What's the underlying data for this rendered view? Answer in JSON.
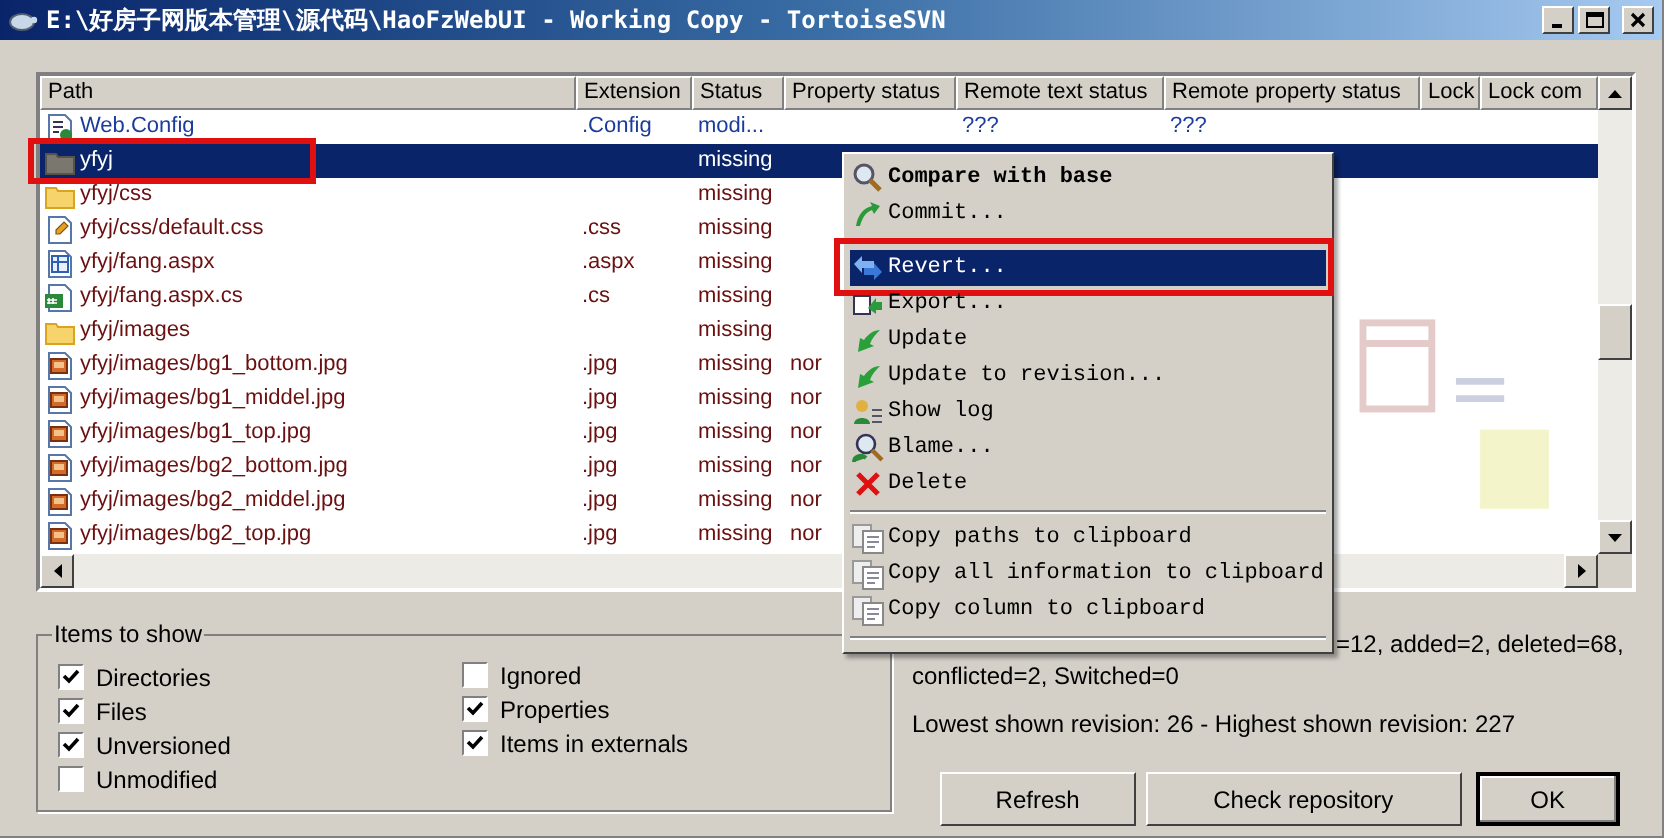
{
  "window": {
    "title": "E:\\好房子网版本管理\\源代码\\HaoFzWebUI - Working Copy - TortoiseSVN"
  },
  "list": {
    "columns": [
      {
        "label": "Path"
      },
      {
        "label": "Extension"
      },
      {
        "label": "Status"
      },
      {
        "label": "Property status"
      },
      {
        "label": "Remote text status"
      },
      {
        "label": "Remote property status"
      },
      {
        "label": "Lock"
      },
      {
        "label": "Lock com"
      }
    ],
    "rows": [
      {
        "kind": "config",
        "path": "Web.Config",
        "extension": ".Config",
        "status": "modi...",
        "remote_text_status": "???",
        "remote_property_status": "???",
        "color": "#1c3c9c",
        "selected": false,
        "highlighted": false
      },
      {
        "kind": "folder-gray",
        "path": "yfyj",
        "status": "missing",
        "selected": true,
        "highlighted": true
      },
      {
        "kind": "folder",
        "path": "yfyj/css",
        "status": "missing",
        "color": "#6b1010",
        "selected": false,
        "highlighted": false
      },
      {
        "kind": "css",
        "path": "yfyj/css/default.css",
        "extension": ".css",
        "status": "missing",
        "color": "#6b1010",
        "selected": false,
        "highlighted": false
      },
      {
        "kind": "aspx",
        "path": "yfyj/fang.aspx",
        "extension": ".aspx",
        "status": "missing",
        "color": "#6b1010",
        "selected": false,
        "highlighted": false
      },
      {
        "kind": "cs",
        "path": "yfyj/fang.aspx.cs",
        "extension": ".cs",
        "status": "missing",
        "color": "#6b1010",
        "selected": false,
        "highlighted": false
      },
      {
        "kind": "folder",
        "path": "yfyj/images",
        "status": "missing",
        "color": "#6b1010",
        "selected": false,
        "highlighted": false
      },
      {
        "kind": "image",
        "path": "yfyj/images/bg1_bottom.jpg",
        "extension": ".jpg",
        "status": "missing",
        "property_status": "nor",
        "color": "#6b1010",
        "selected": false,
        "highlighted": false
      },
      {
        "kind": "image",
        "path": "yfyj/images/bg1_middel.jpg",
        "extension": ".jpg",
        "status": "missing",
        "property_status": "nor",
        "color": "#6b1010",
        "selected": false,
        "highlighted": false
      },
      {
        "kind": "image",
        "path": "yfyj/images/bg1_top.jpg",
        "extension": ".jpg",
        "status": "missing",
        "property_status": "nor",
        "color": "#6b1010",
        "selected": false,
        "highlighted": false
      },
      {
        "kind": "image",
        "path": "yfyj/images/bg2_bottom.jpg",
        "extension": ".jpg",
        "status": "missing",
        "property_status": "nor",
        "color": "#6b1010",
        "selected": false,
        "highlighted": false
      },
      {
        "kind": "image",
        "path": "yfyj/images/bg2_middel.jpg",
        "extension": ".jpg",
        "status": "missing",
        "property_status": "nor",
        "color": "#6b1010",
        "selected": false,
        "highlighted": false
      },
      {
        "kind": "image",
        "path": "yfyj/images/bg2_top.jpg",
        "extension": ".jpg",
        "status": "missing",
        "property_status": "nor",
        "color": "#6b1010",
        "selected": false,
        "highlighted": false
      }
    ]
  },
  "context_menu": {
    "items": [
      {
        "kind": "compare",
        "label": "Compare with base",
        "default": true,
        "selected": false,
        "highlighted": false
      },
      {
        "kind": "commit",
        "label": "Commit...",
        "default": false,
        "selected": false,
        "highlighted": false
      },
      {
        "kind": "gap"
      },
      {
        "kind": "revert",
        "label": "Revert...",
        "default": false,
        "selected": true,
        "highlighted": true
      },
      {
        "kind": "export",
        "label": "Export...",
        "default": false,
        "selected": false,
        "highlighted": false
      },
      {
        "kind": "update",
        "label": "Update",
        "default": false,
        "selected": false,
        "highlighted": false
      },
      {
        "kind": "update",
        "label": "Update to revision...",
        "default": false,
        "selected": false,
        "highlighted": false
      },
      {
        "kind": "log",
        "label": "Show log",
        "default": false,
        "selected": false,
        "highlighted": false
      },
      {
        "kind": "blame",
        "label": "Blame...",
        "default": false,
        "selected": false,
        "highlighted": false
      },
      {
        "kind": "delete",
        "label": "Delete",
        "default": false,
        "selected": false,
        "highlighted": false
      },
      {
        "kind": "separator"
      },
      {
        "kind": "copy",
        "label": "Copy paths to clipboard",
        "default": false,
        "selected": false,
        "highlighted": false
      },
      {
        "kind": "copy",
        "label": "Copy all information to clipboard",
        "default": false,
        "selected": false,
        "highlighted": false
      },
      {
        "kind": "copy",
        "label": "Copy column to clipboard",
        "default": false,
        "selected": false,
        "highlighted": false
      },
      {
        "kind": "separator"
      }
    ]
  },
  "items_to_show": {
    "title": "Items to show",
    "columns": [
      [
        {
          "label": "Directories",
          "checked": true
        },
        {
          "label": "Files",
          "checked": true
        },
        {
          "label": "Unversioned",
          "checked": true
        },
        {
          "label": "Unmodified",
          "checked": false
        }
      ],
      [
        {
          "label": "Ignored",
          "checked": false
        },
        {
          "label": "Properties",
          "checked": true
        },
        {
          "label": "Items in externals",
          "checked": true
        }
      ]
    ]
  },
  "summary": {
    "lines": [
      "=12, added=2, deleted=68,",
      "conflicted=2, Switched=0"
    ],
    "revision": "Lowest shown revision: 26 - Highest shown revision: 227"
  },
  "buttons": [
    {
      "label": "Refresh",
      "default": false
    },
    {
      "label": "Check repository",
      "default": false
    },
    {
      "label": "OK",
      "default": true
    }
  ]
}
